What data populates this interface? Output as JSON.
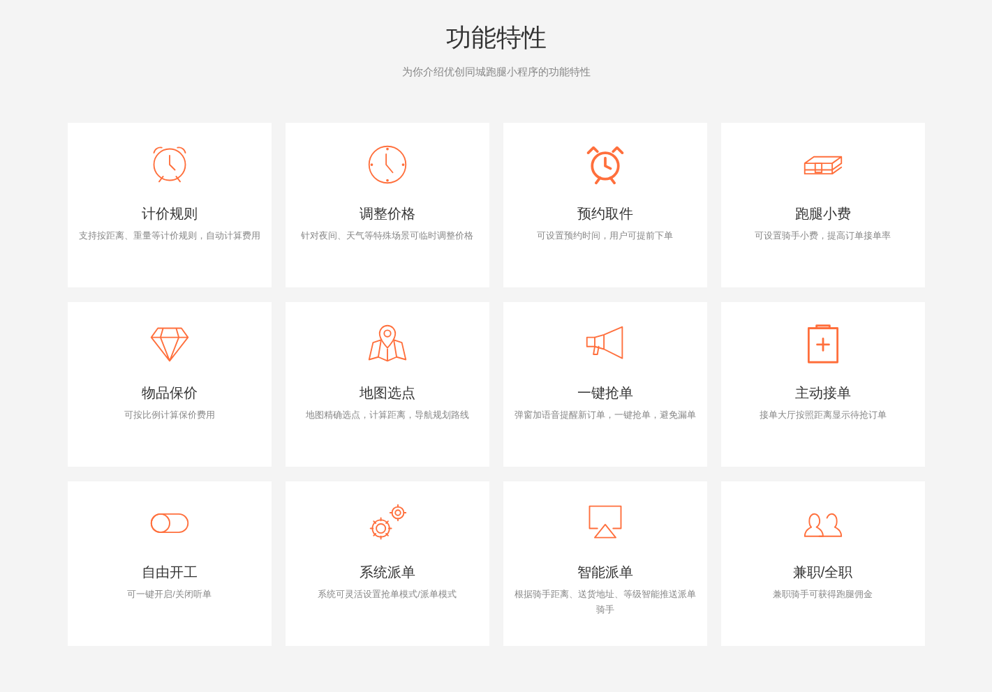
{
  "header": {
    "title": "功能特性",
    "subtitle": "为你介绍优创同城跑腿小程序的功能特性"
  },
  "features": [
    {
      "title": "计价规则",
      "description": "支持按距离、重量等计价规则，自动计算费用"
    },
    {
      "title": "调整价格",
      "description": "针对夜间、天气等特殊场景可临时调整价格"
    },
    {
      "title": "预约取件",
      "description": "可设置预约时间，用户可提前下单"
    },
    {
      "title": "跑腿小费",
      "description": "可设置骑手小费，提高订单接单率"
    },
    {
      "title": "物品保价",
      "description": "可按比例计算保价费用"
    },
    {
      "title": "地图选点",
      "description": "地图精确选点，计算距离，导航规划路线"
    },
    {
      "title": "一键抢单",
      "description": "弹窗加语音提醒新订单，一键抢单，避免漏单"
    },
    {
      "title": "主动接单",
      "description": "接单大厅按照距离显示待抢订单"
    },
    {
      "title": "自由开工",
      "description": "可一键开启/关闭听单"
    },
    {
      "title": "系统派单",
      "description": "系统可灵活设置抢单模式/派单模式"
    },
    {
      "title": "智能派单",
      "description": "根据骑手距离、送货地址、等级智能推送派单骑手"
    },
    {
      "title": "兼职/全职",
      "description": "兼职骑手可获得跑腿佣金"
    }
  ]
}
